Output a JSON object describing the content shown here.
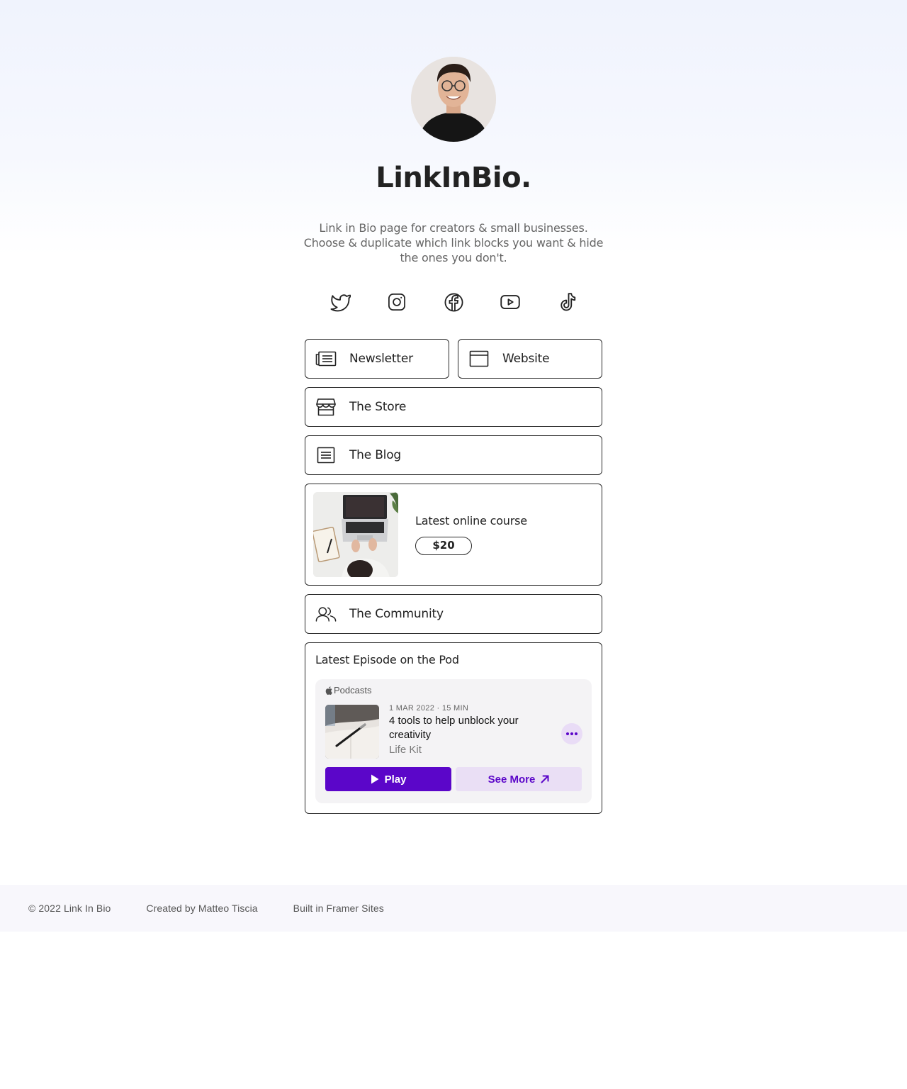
{
  "profile": {
    "title": "LinkInBio.",
    "bio_lines": [
      "Link in Bio page for creators & small businesses.",
      "Choose & duplicate which link blocks you want & hide",
      "the ones you don't."
    ]
  },
  "socials": [
    {
      "icon": "twitter-icon"
    },
    {
      "icon": "instagram-icon"
    },
    {
      "icon": "facebook-icon"
    },
    {
      "icon": "youtube-icon"
    },
    {
      "icon": "tiktok-icon"
    }
  ],
  "links": {
    "newsletter": {
      "label": "Newsletter",
      "icon": "newspaper-icon"
    },
    "website": {
      "label": "Website",
      "icon": "browser-window-icon"
    },
    "store": {
      "label": "The Store",
      "icon": "storefront-icon"
    },
    "blog": {
      "label": "The Blog",
      "icon": "document-lines-icon"
    },
    "community": {
      "label": "The Community",
      "icon": "users-icon"
    }
  },
  "course": {
    "title": "Latest online course",
    "price": "$20"
  },
  "podcast": {
    "heading": "Latest Episode on the Pod",
    "brand": "Podcasts",
    "meta": "1 MAR 2022 · 15 MIN",
    "episode_title": "4 tools to help unblock your creativity",
    "show": "Life Kit",
    "play_label": "Play",
    "see_more_label": "See More",
    "accent": "#5b06c9"
  },
  "footer": {
    "copyright": "© 2022 Link In Bio",
    "created_by": "Created by Matteo Tiscia",
    "built_in": "Built in Framer Sites"
  }
}
